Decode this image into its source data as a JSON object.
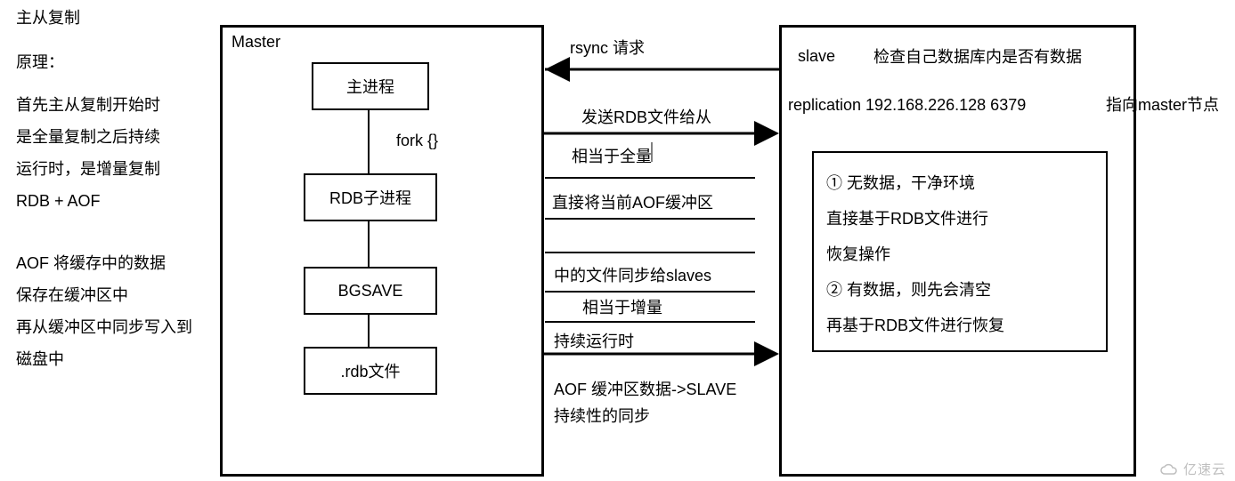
{
  "title": "主从复制",
  "leftNotes": {
    "principle": "原理：",
    "para1_l1": "首先主从复制开始时",
    "para1_l2": "是全量复制之后持续",
    "para1_l3": "运行时，是增量复制",
    "para1_l4": "RDB + AOF",
    "para2_l1": "AOF 将缓存中的数据",
    "para2_l2": "保存在缓冲区中",
    "para2_l3": "再从缓冲区中同步写入到",
    "para2_l4": "磁盘中"
  },
  "master": {
    "label": "Master",
    "boxes": {
      "mainProc": "主进程",
      "rdbChild": "RDB子进程",
      "bgsave": "BGSAVE",
      "rdbFile": ".rdb文件"
    },
    "fork": "fork {}"
  },
  "arrows": {
    "rsync": "rsync 请求",
    "sendRDB": "发送RDB文件给从",
    "fullEq": "相当于全量",
    "aofBuf": "直接将当前AOF缓冲区",
    "syncSlaves": "中的文件同步给slaves",
    "incrEq": "相当于增量",
    "keepRun": "持续运行时",
    "aofToSlave1": "AOF 缓冲区数据->SLAVE",
    "aofToSlave2": "持续性的同步"
  },
  "slave": {
    "label": "slave",
    "check": "检查自己数据库内是否有数据",
    "replication": "replication 192.168.226.128 6379",
    "pointMaster": "指向master节点",
    "inner": {
      "l1": "① 无数据，干净环境",
      "l2": "直接基于RDB文件进行",
      "l3": "恢复操作",
      "l4": "② 有数据，则先会清空",
      "l5": "再基于RDB文件进行恢复"
    }
  },
  "watermark": "亿速云"
}
